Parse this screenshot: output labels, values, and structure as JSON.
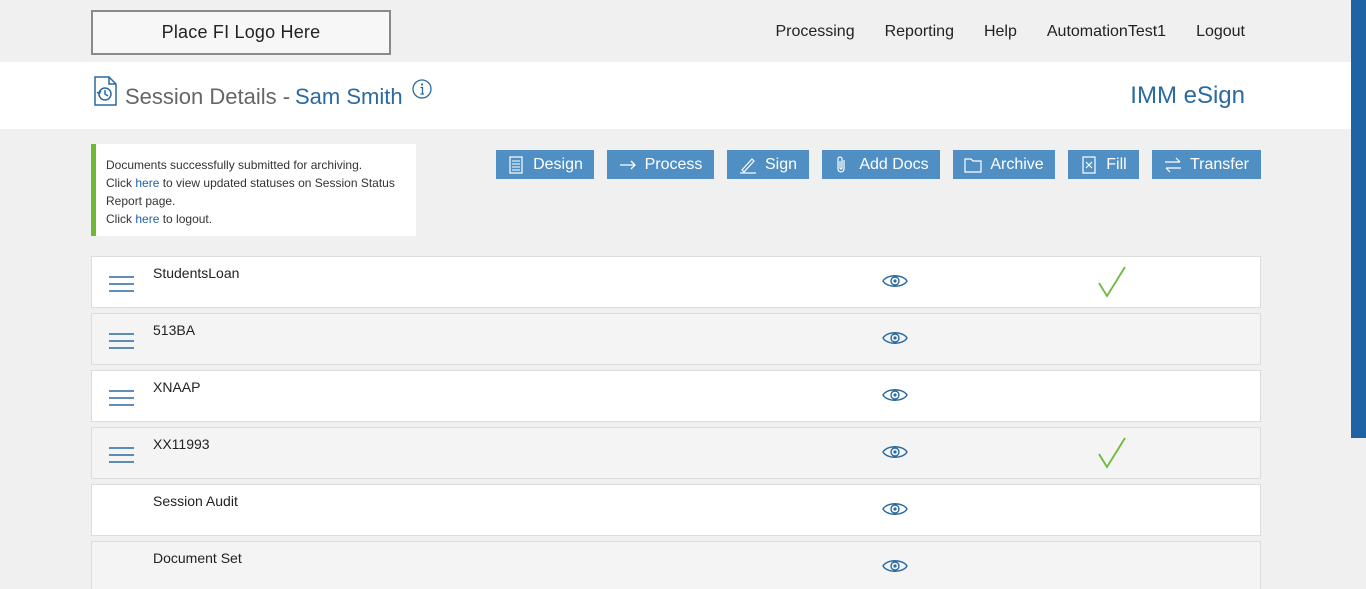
{
  "topbar": {
    "logo_text": "Place FI Logo Here",
    "nav": [
      "Processing",
      "Reporting",
      "Help",
      "AutomationTest1",
      "Logout"
    ]
  },
  "header": {
    "title": "Session Details -",
    "name": "Sam Smith",
    "brand": "IMM eSign"
  },
  "notice": {
    "line1": "Documents successfully submitted for archiving.",
    "line2_pre": "Click ",
    "line2_link": "here",
    "line2_post": " to view updated statuses on Session Status Report page.",
    "line3_pre": "Click ",
    "line3_link": "here",
    "line3_post": " to logout."
  },
  "toolbar": {
    "design": "Design",
    "process": "Process",
    "sign": "Sign",
    "add_docs": "Add Docs",
    "archive": "Archive",
    "fill": "Fill",
    "transfer": "Transfer"
  },
  "rows": [
    {
      "label": "StudentsLoan",
      "menu": true,
      "checked": true
    },
    {
      "label": "513BA",
      "menu": true,
      "checked": false
    },
    {
      "label": "XNAAP",
      "menu": true,
      "checked": false
    },
    {
      "label": "XX11993",
      "menu": true,
      "checked": true
    },
    {
      "label": "Session Audit",
      "menu": false,
      "checked": false
    },
    {
      "label": "Document Set",
      "menu": false,
      "checked": false
    }
  ],
  "colors": {
    "accent": "#4f8fc4",
    "brand": "#2a6aa0",
    "success": "#6cba3a"
  }
}
